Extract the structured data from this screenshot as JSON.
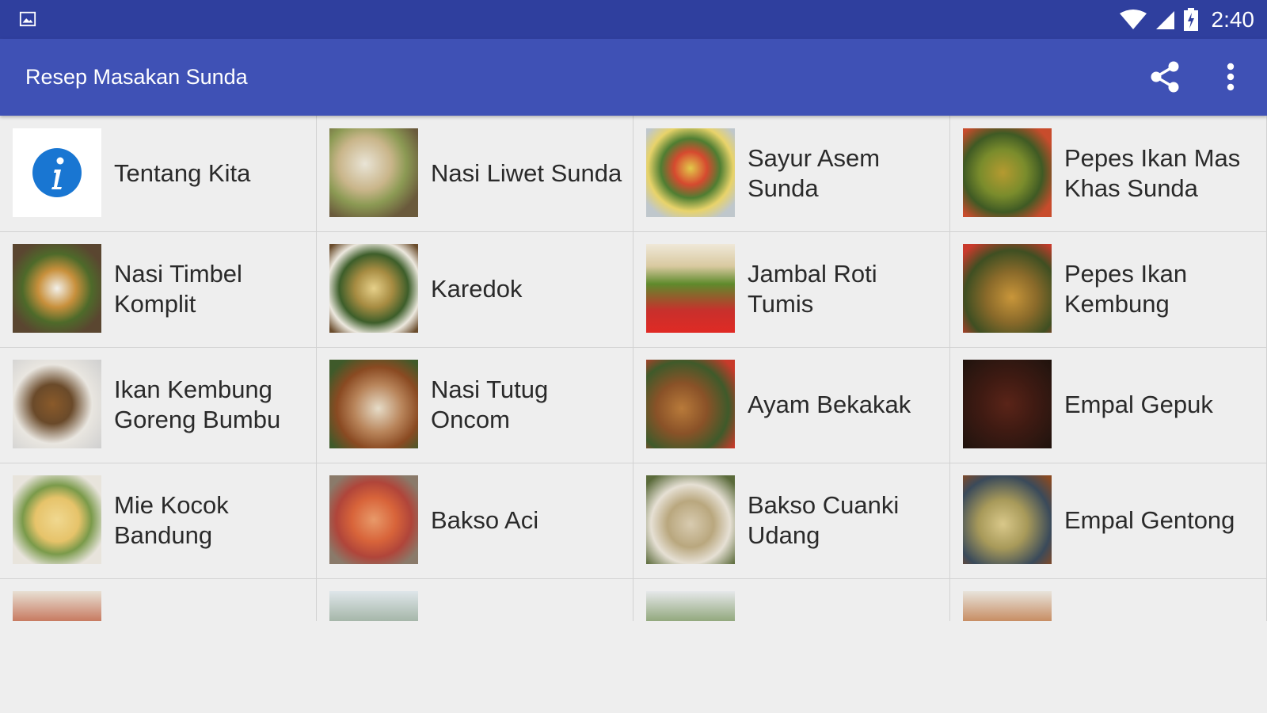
{
  "status_bar": {
    "time": "2:40",
    "icons": [
      "image-notification-icon",
      "wifi-icon",
      "cell-signal-icon",
      "battery-charging-icon"
    ]
  },
  "app_bar": {
    "title": "Resep Masakan Sunda",
    "actions": [
      "share-icon",
      "more-vert-icon"
    ]
  },
  "colors": {
    "status_bar": "#2f3f9e",
    "app_bar": "#3f51b5",
    "background": "#eeeeee",
    "info_icon": "#1976d2"
  },
  "recipes": [
    {
      "label": "Tentang Kita",
      "icon": "info-icon"
    },
    {
      "label": "Nasi Liwet Sunda",
      "icon": "food-photo"
    },
    {
      "label": "Sayur Asem Sunda",
      "icon": "food-photo"
    },
    {
      "label": "Pepes Ikan Mas Khas Sunda",
      "icon": "food-photo"
    },
    {
      "label": "Nasi Timbel Komplit",
      "icon": "food-photo"
    },
    {
      "label": "Karedok",
      "icon": "food-photo"
    },
    {
      "label": "Jambal Roti Tumis",
      "icon": "food-photo"
    },
    {
      "label": "Pepes Ikan Kembung",
      "icon": "food-photo"
    },
    {
      "label": "Ikan Kembung Goreng Bumbu",
      "icon": "food-photo"
    },
    {
      "label": "Nasi Tutug Oncom",
      "icon": "food-photo"
    },
    {
      "label": "Ayam Bekakak",
      "icon": "food-photo"
    },
    {
      "label": "Empal Gepuk",
      "icon": "food-photo"
    },
    {
      "label": "Mie Kocok Bandung",
      "icon": "food-photo"
    },
    {
      "label": "Bakso Aci",
      "icon": "food-photo"
    },
    {
      "label": "Bakso Cuanki Udang",
      "icon": "food-photo"
    },
    {
      "label": "Empal Gentong",
      "icon": "food-photo"
    }
  ]
}
